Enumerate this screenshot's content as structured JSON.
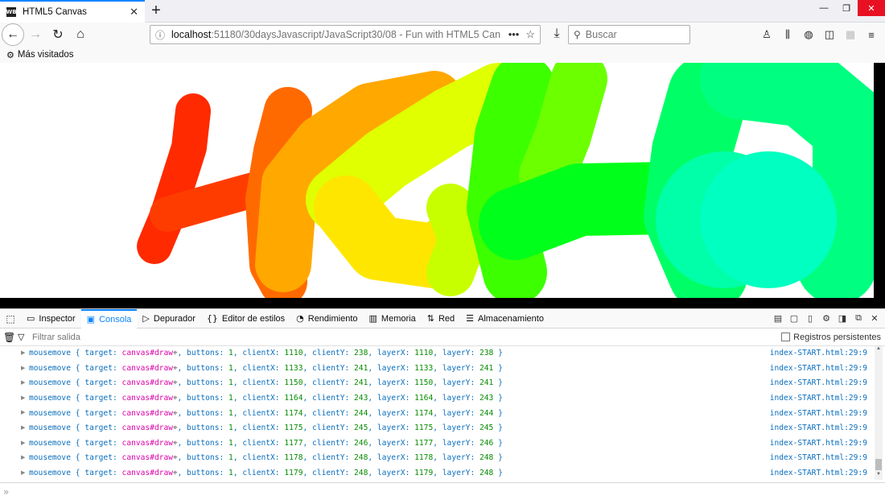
{
  "browser": {
    "tab_title": "HTML5 Canvas",
    "favicon_text": "WB",
    "url_host": "localhost",
    "url_rest": ":51180/30daysJavascript/JavaScript30/08 - Fun with HTML5 Can",
    "search_placeholder": "Buscar",
    "bookmark_label": "Más visitados"
  },
  "colors": {
    "accent": "#0a84ff",
    "stroke_hues": [
      "#ff1a00",
      "#ff5a00",
      "#ffa500",
      "#ffd400",
      "#e8ff00",
      "#b4ff00",
      "#4cff00",
      "#00ff1a",
      "#00ff6a",
      "#00ffbf"
    ]
  },
  "devtools": {
    "tabs": [
      {
        "label": "Inspector",
        "icon": "inspector-icon"
      },
      {
        "label": "Consola",
        "icon": "console-icon"
      },
      {
        "label": "Depurador",
        "icon": "debugger-icon"
      },
      {
        "label": "Editor de estilos",
        "icon": "style-editor-icon"
      },
      {
        "label": "Rendimiento",
        "icon": "performance-icon"
      },
      {
        "label": "Memoria",
        "icon": "memory-icon"
      },
      {
        "label": "Red",
        "icon": "network-icon"
      },
      {
        "label": "Almacenamiento",
        "icon": "storage-icon"
      }
    ],
    "filter_placeholder": "Filtrar salida",
    "persist_label": "Registros persistentes",
    "log_source": "index-START.html:29:9",
    "logs": [
      {
        "x": "1110",
        "y": "238"
      },
      {
        "x": "1133",
        "y": "241"
      },
      {
        "x": "1150",
        "y": "241"
      },
      {
        "x": "1164",
        "y": "243"
      },
      {
        "x": "1174",
        "y": "244"
      },
      {
        "x": "1175",
        "y": "245"
      },
      {
        "x": "1177",
        "y": "246"
      },
      {
        "x": "1178",
        "y": "248"
      },
      {
        "x": "1179",
        "y": "248"
      }
    ],
    "log_text": {
      "event": "mousemove",
      "open": "{",
      "target_key": "target:",
      "target_val": "canvas#draw",
      "buttons_key": ", buttons:",
      "buttons_val": "1",
      "clientx_key": ", clientX:",
      "clienty_key": ", clientY:",
      "layerx_key": ", layerX:",
      "layery_key": ", layerY:",
      "close": "}"
    }
  }
}
